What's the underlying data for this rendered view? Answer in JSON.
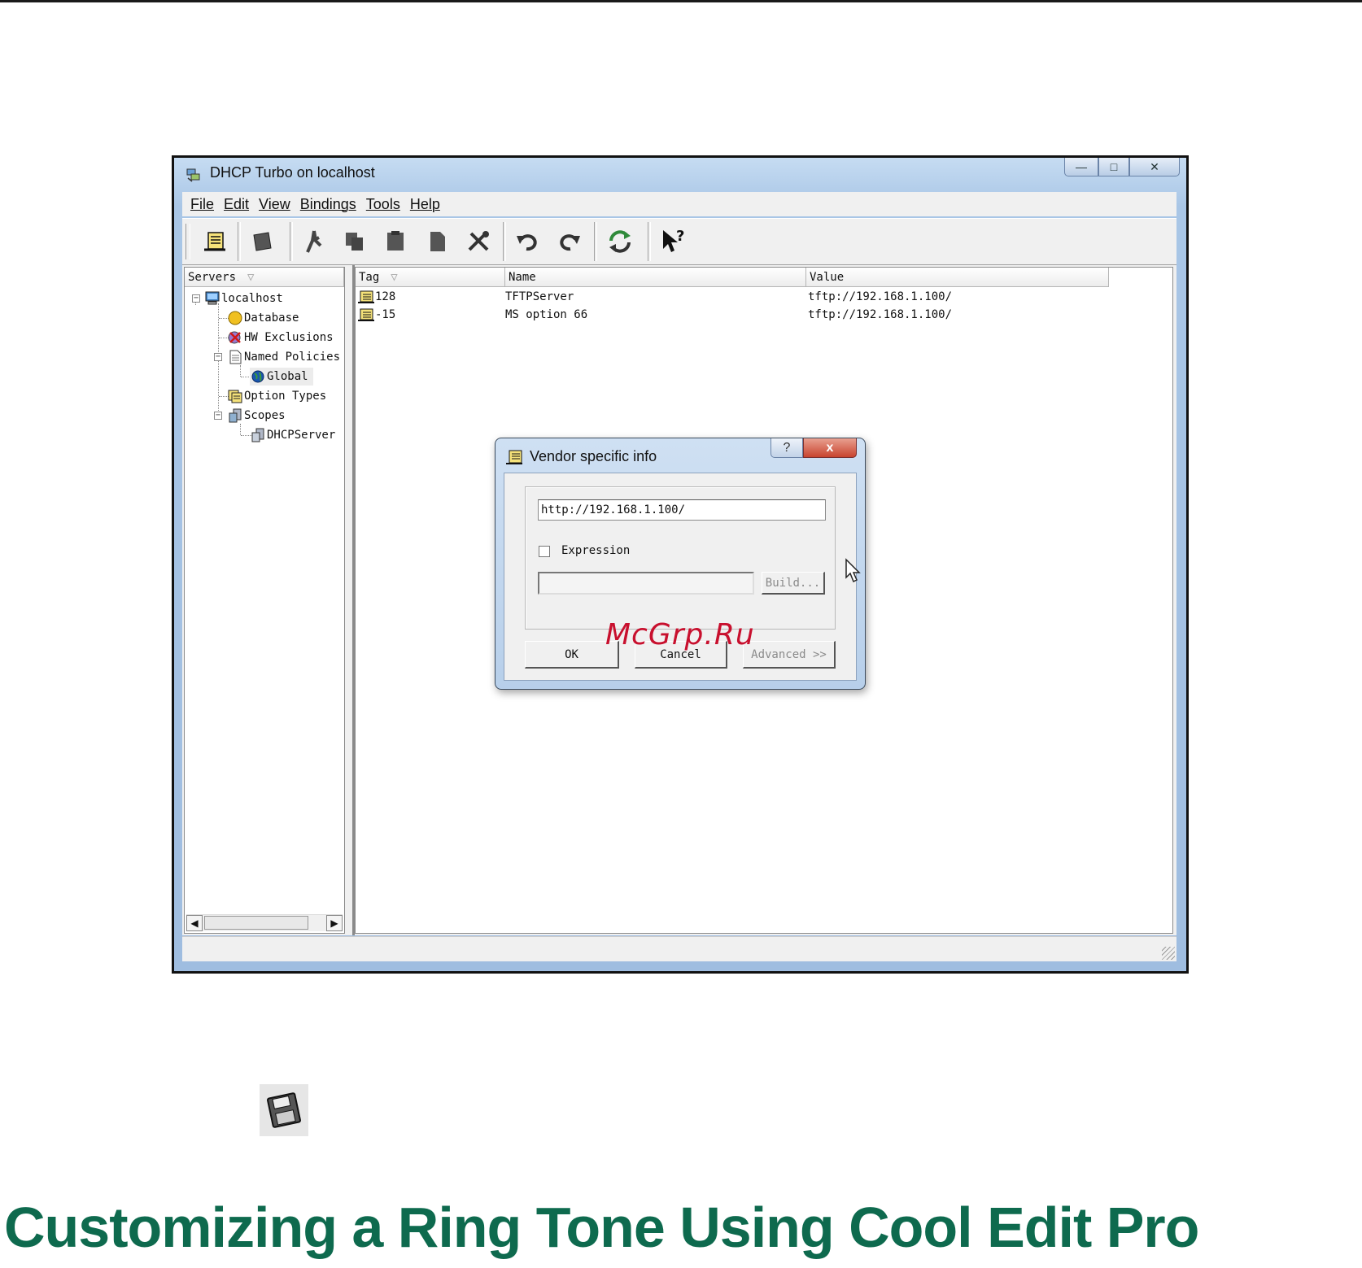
{
  "window": {
    "title": "DHCP Turbo on localhost",
    "menu": [
      "File",
      "Edit",
      "View",
      "Bindings",
      "Tools",
      "Help"
    ],
    "toolbar_icons": [
      "option-icon",
      "erase-icon",
      "cut-icon",
      "copy-icon",
      "paste-icon",
      "new-icon",
      "properties-icon",
      "undo-icon",
      "redo-icon",
      "refresh-icon",
      "context-help-icon"
    ]
  },
  "tree": {
    "header": "Servers",
    "nodes": [
      {
        "label": "localhost",
        "icon": "computer-icon"
      },
      {
        "label": "Database",
        "icon": "database-icon"
      },
      {
        "label": "HW Exclusions",
        "icon": "exclusions-icon"
      },
      {
        "label": "Named Policies",
        "icon": "policies-icon"
      },
      {
        "label": "Global",
        "icon": "globe-icon"
      },
      {
        "label": "Option Types",
        "icon": "option-types-icon"
      },
      {
        "label": "Scopes",
        "icon": "scopes-icon"
      },
      {
        "label": "DHCPServer",
        "icon": "server-icon"
      }
    ]
  },
  "list": {
    "columns": [
      "Tag",
      "Name",
      "Value"
    ],
    "rows": [
      {
        "tag": "128",
        "name": "TFTPServer",
        "value": "tftp://192.168.1.100/"
      },
      {
        "tag": "-15",
        "name": "MS option 66",
        "value": "tftp://192.168.1.100/"
      }
    ]
  },
  "dialog": {
    "title": "Vendor specific info",
    "help_label": "?",
    "close_label": "x",
    "value": "http://192.168.1.100/",
    "expression_label": "Expression",
    "expression_checked": false,
    "expression_value": "",
    "build_label": "Build...",
    "ok_label": "OK",
    "cancel_label": "Cancel",
    "advanced_label": "Advanced >>"
  },
  "watermark": "McGrp.Ru",
  "heading": "Customizing a Ring Tone Using Cool Edit Pro"
}
